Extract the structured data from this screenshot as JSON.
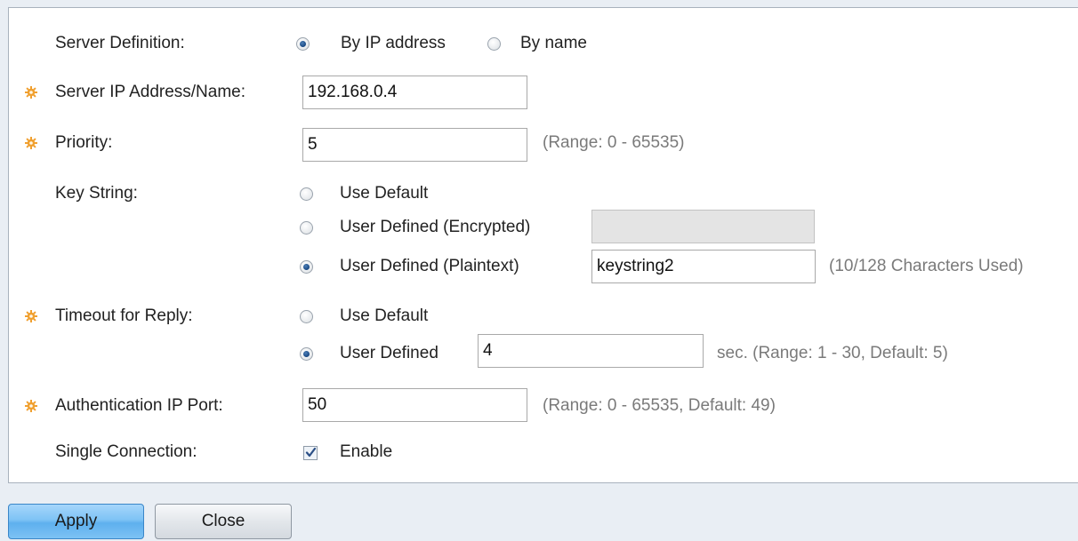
{
  "form": {
    "server_definition": {
      "label": "Server Definition:",
      "options": [
        "By IP address",
        "By name"
      ],
      "selected": "By IP address"
    },
    "server_ip": {
      "label": "Server IP Address/Name:",
      "value": "192.168.0.4"
    },
    "priority": {
      "label": "Priority:",
      "value": "5",
      "hint": "(Range: 0 - 65535)"
    },
    "key_string": {
      "label": "Key String:",
      "options": [
        "Use Default",
        "User Defined (Encrypted)",
        "User Defined (Plaintext)"
      ],
      "selected": "User Defined (Plaintext)",
      "encrypted_value": "",
      "plaintext_value": "keystring2",
      "hint": "(10/128 Characters Used)"
    },
    "timeout": {
      "label": "Timeout for Reply:",
      "options": [
        "Use Default",
        "User Defined"
      ],
      "selected": "User Defined",
      "value": "4",
      "hint": "sec. (Range: 1 - 30, Default: 5)"
    },
    "auth_port": {
      "label": "Authentication IP Port:",
      "value": "50",
      "hint": "(Range: 0 - 65535, Default: 49)"
    },
    "single_connection": {
      "label": "Single Connection:",
      "checkbox_label": "Enable",
      "checked": true
    }
  },
  "buttons": {
    "apply": "Apply",
    "close": "Close"
  },
  "colors": {
    "required_icon": "#f0a030",
    "primary_button": "#7ec3f5",
    "page_background": "#e9eef4",
    "hint_text": "#7a7a7a"
  },
  "icons": {
    "required": "gear-icon",
    "checkmark": "check-icon"
  }
}
